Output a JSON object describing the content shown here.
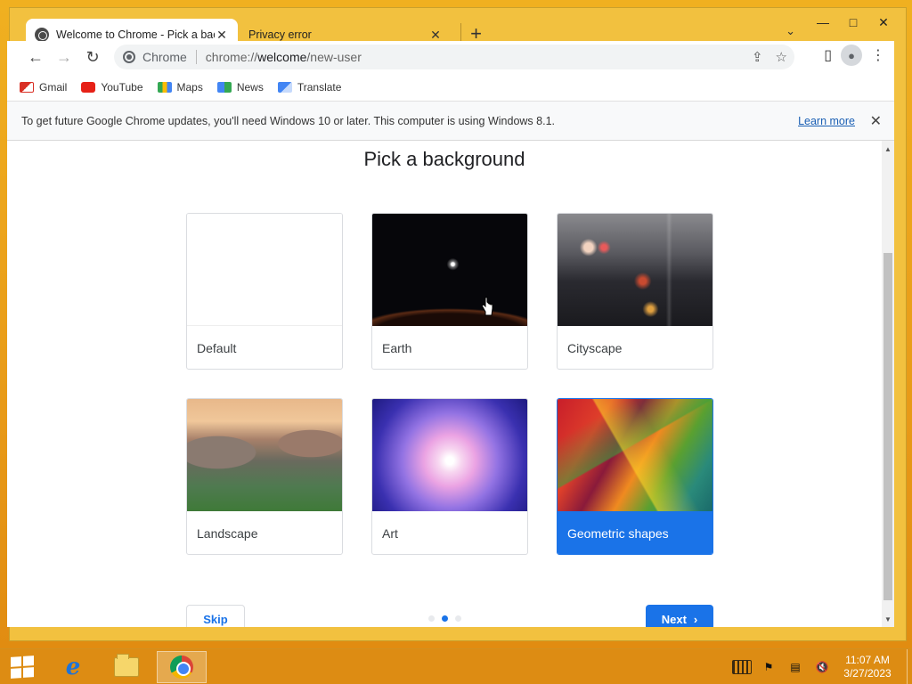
{
  "window": {
    "tabs": [
      {
        "title": "Welcome to Chrome - Pick a bac",
        "active": true
      },
      {
        "title": "Privacy error",
        "active": false
      }
    ]
  },
  "omnibox": {
    "chip": "Chrome",
    "url_prefix": "chrome://",
    "url_host": "welcome",
    "url_path": "/new-user"
  },
  "bookmarks": [
    {
      "label": "Gmail",
      "icon": "gmail-icon"
    },
    {
      "label": "YouTube",
      "icon": "youtube-icon"
    },
    {
      "label": "Maps",
      "icon": "maps-icon"
    },
    {
      "label": "News",
      "icon": "news-icon"
    },
    {
      "label": "Translate",
      "icon": "translate-icon"
    }
  ],
  "infobar": {
    "message": "To get future Google Chrome updates, you'll need Windows 10 or later. This computer is using Windows 8.1.",
    "link": "Learn more"
  },
  "page": {
    "title": "Pick a background",
    "backgrounds": [
      {
        "label": "Default",
        "selected": false
      },
      {
        "label": "Earth",
        "selected": false
      },
      {
        "label": "Cityscape",
        "selected": false
      },
      {
        "label": "Landscape",
        "selected": false
      },
      {
        "label": "Art",
        "selected": false
      },
      {
        "label": "Geometric shapes",
        "selected": true
      }
    ],
    "skip_label": "Skip",
    "next_label": "Next",
    "step_dots": 3,
    "active_dot": 1
  },
  "taskbar": {
    "clock_time": "11:07 AM",
    "clock_date": "3/27/2023"
  },
  "colors": {
    "accent": "#1a73e8",
    "desktop": "#e8a020"
  }
}
